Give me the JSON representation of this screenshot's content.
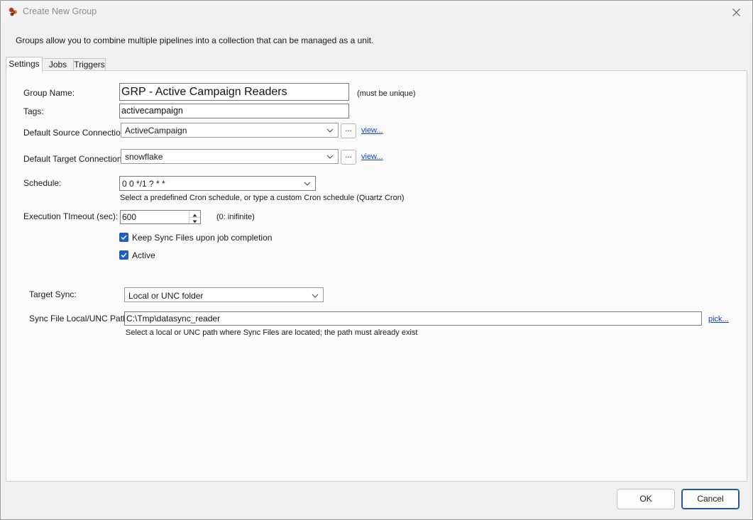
{
  "window": {
    "title": "Create New Group"
  },
  "description": "Groups allow you to combine multiple pipelines into a collection that can be managed as a unit.",
  "tabs": [
    {
      "label": "Settings",
      "active": true
    },
    {
      "label": "Jobs",
      "active": false
    },
    {
      "label": "Triggers",
      "active": false
    }
  ],
  "settings": {
    "group_name": {
      "label": "Group Name:",
      "value": "GRP - Active Campaign Readers",
      "hint": "(must be unique)"
    },
    "tags": {
      "label": "Tags:",
      "value": "activecampaign"
    },
    "source_connection": {
      "label": "Default Source Connection:",
      "value": "ActiveCampaign",
      "browse_label": "...",
      "view_label": "view..."
    },
    "target_connection": {
      "label": "Default Target Connection:",
      "value": "snowflake",
      "browse_label": "...",
      "view_label": "view..."
    },
    "schedule": {
      "label": "Schedule:",
      "value": "0 0 */1 ? * *",
      "hint": "Select a predefined Cron schedule, or type a custom Cron schedule (Quartz Cron)"
    },
    "timeout": {
      "label": "Execution TImeout (sec):",
      "value": "600",
      "hint": "(0: inifinite)"
    },
    "keep_sync_files": {
      "label": "Keep Sync Files upon job completion",
      "checked": true
    },
    "active": {
      "label": "Active",
      "checked": true
    },
    "target_sync": {
      "label": "Target Sync:",
      "value": "Local or UNC folder"
    },
    "sync_path": {
      "label": "Sync File Local/UNC Path:",
      "value": "C:\\Tmp\\datasync_reader",
      "pick_label": "pick...",
      "hint": "Select a local or UNC path where Sync Files are located; the path must already exist"
    }
  },
  "footer": {
    "ok_label": "OK",
    "cancel_label": "Cancel"
  },
  "colors": {
    "accent": "#1f5fbf",
    "link": "#0a3fd6",
    "panel": "#fbfbfb",
    "background": "#f0f0f0"
  }
}
